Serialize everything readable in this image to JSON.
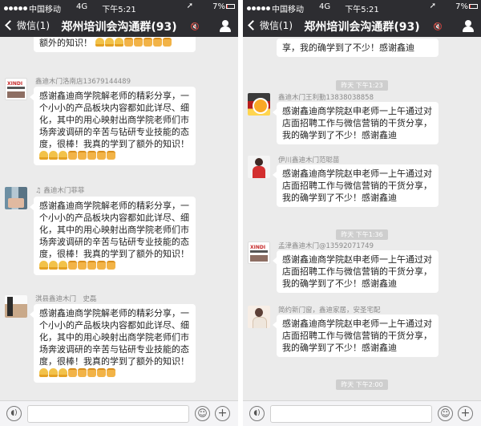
{
  "status_bar": {
    "carrier": "中国移动",
    "network": "4G",
    "time": "下午5:21",
    "battery": "7%"
  },
  "nav": {
    "back_label": "微信(1)",
    "title": "郑州培训会沟通群(93)"
  },
  "messages_left": [
    {
      "bubble": "额外的知识！"
    },
    {
      "sender": "鑫迪木门洛南店13679144489",
      "bubble": "感谢鑫迪商学院解老师的精彩分享，一个小小的产品板块内容都如此详尽、细化，其中的用心映射出商学院老师们市场奔波调研的辛苦与钻研专业技能的态度，很棒！我真的学到了额外的知识！"
    },
    {
      "sender": "鑫迪木门菲菲",
      "bubble": "感谢鑫迪商学院解老师的精彩分享，一个小小的产品板块内容都如此详尽、细化，其中的用心映射出商学院老师们市场奔波调研的辛苦与钻研专业技能的态度，很棒！我真的学到了额外的知识！"
    },
    {
      "sender": "淇县鑫迪木门　史磊",
      "bubble": "感谢鑫迪商学院解老师的精彩分享，一个小小的产品板块内容都如此详尽、细化，其中的用心映射出商学院老师们市场奔波调研的辛苦与钻研专业技能的态度，很棒！我真的学到了额外的知识！"
    }
  ],
  "messages_right": [
    {
      "bubble": "享，我的确学到了不少！感谢鑫迪"
    },
    {
      "timestamp": "昨天 下午1:23"
    },
    {
      "sender": "鑫迪木门王利勤13838038858",
      "bubble": "感谢鑫迪商学院赵申老师一上午通过对店面招聘工作与微信营销的干货分享，我的确学到了不少！感谢鑫迪"
    },
    {
      "sender": "伊川鑫迪木门范聪苗",
      "bubble": "感谢鑫迪商学院赵申老师一上午通过对店面招聘工作与微信营销的干货分享，我的确学到了不少！感谢鑫迪"
    },
    {
      "timestamp": "昨天 下午1:36"
    },
    {
      "sender": "孟津鑫迪木门@13592071749",
      "bubble": "感谢鑫迪商学院赵申老师一上午通过对店面招聘工作与微信营销的干货分享，我的确学到了不少！感谢鑫迪"
    },
    {
      "sender": "简约新门窗，鑫迪家居，安圣宅配",
      "bubble": "感谢鑫迪商学院赵申老师一上午通过对店面招聘工作与微信营销的干货分享，我的确学到了不少！感谢鑫迪"
    },
    {
      "timestamp": "昨天 下午2:00"
    }
  ]
}
